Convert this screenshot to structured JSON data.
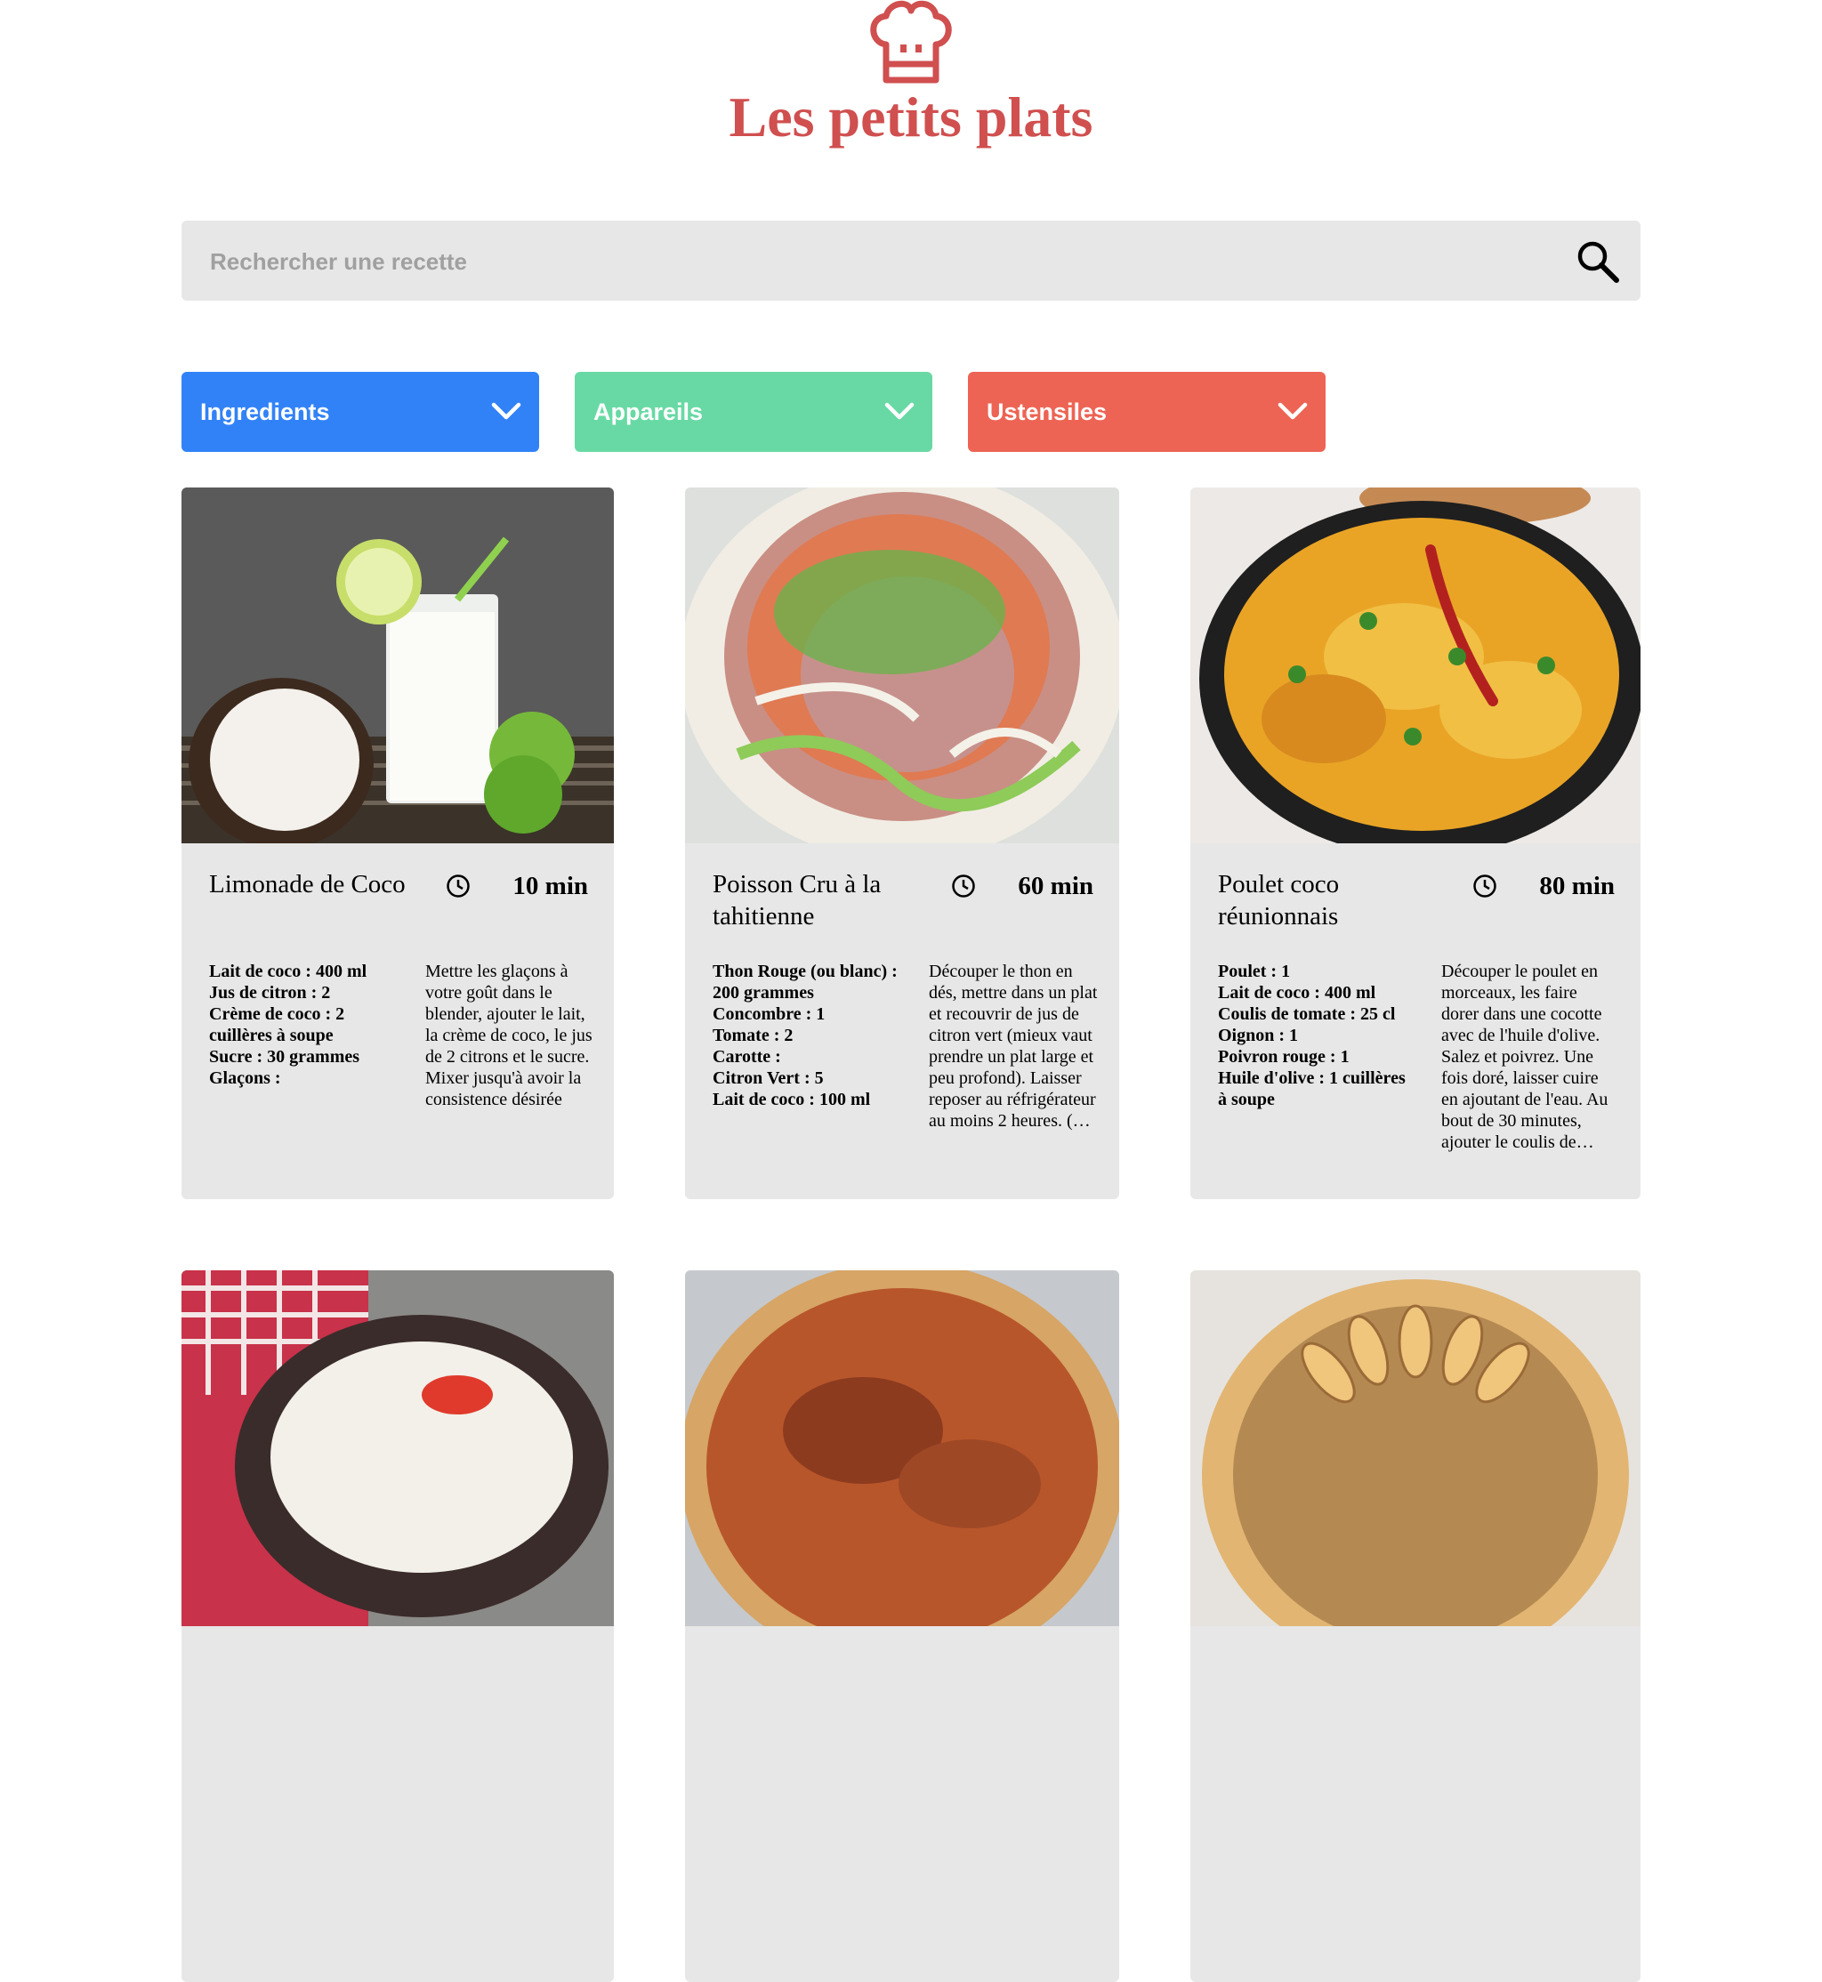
{
  "brand": {
    "title": "Les petits plats",
    "color": "#d04f4f"
  },
  "search": {
    "placeholder": "Rechercher une recette",
    "value": ""
  },
  "filters": [
    {
      "label": "Ingredients",
      "color": "#3282f7",
      "icon": "chevron-down-icon"
    },
    {
      "label": "Appareils",
      "color": "#68d9a4",
      "icon": "chevron-down-icon"
    },
    {
      "label": "Ustensiles",
      "color": "#ed6454",
      "icon": "chevron-down-icon"
    }
  ],
  "recipes": [
    {
      "name": "Limonade de Coco",
      "time": "10 min",
      "ingredients": [
        "Lait de coco : 400 ml",
        "Jus de citron : 2",
        "Crème de coco : 2 cuillères à soupe",
        "Sucre : 30 grammes",
        "Glaçons :"
      ],
      "description": "Mettre les glaçons à votre goût dans le blender, ajouter le lait, la crème de coco, le jus de 2 citrons et le sucre. Mixer jusqu'à avoir la consistence désirée"
    },
    {
      "name": "Poisson Cru à la tahitienne",
      "time": "60 min",
      "ingredients": [
        "Thon Rouge (ou blanc) : 200 grammes",
        "Concombre : 1",
        "Tomate : 2",
        "Carotte :",
        "Citron Vert : 5",
        "Lait de coco : 100 ml"
      ],
      "description": "Découper le thon en dés, mettre dans un plat et recouvrir de jus de citron vert (mieux vaut prendre un plat large et peu profond). Laisser reposer au réfrigérateur au moins 2 heures. (…"
    },
    {
      "name": "Poulet coco réunionnais",
      "time": "80 min",
      "ingredients": [
        "Poulet : 1",
        "Lait de coco : 400 ml",
        "Coulis de tomate : 25 cl",
        "Oignon : 1",
        "Poivron rouge : 1",
        "Huile d'olive : 1 cuillères à soupe"
      ],
      "description": "Découper le poulet en morceaux, les faire dorer dans une cocotte avec de l'huile d'olive. Salez et poivrez. Une fois doré, laisser cuire en ajoutant de l'eau. Au bout de 30 minutes, ajouter le coulis de…"
    }
  ]
}
